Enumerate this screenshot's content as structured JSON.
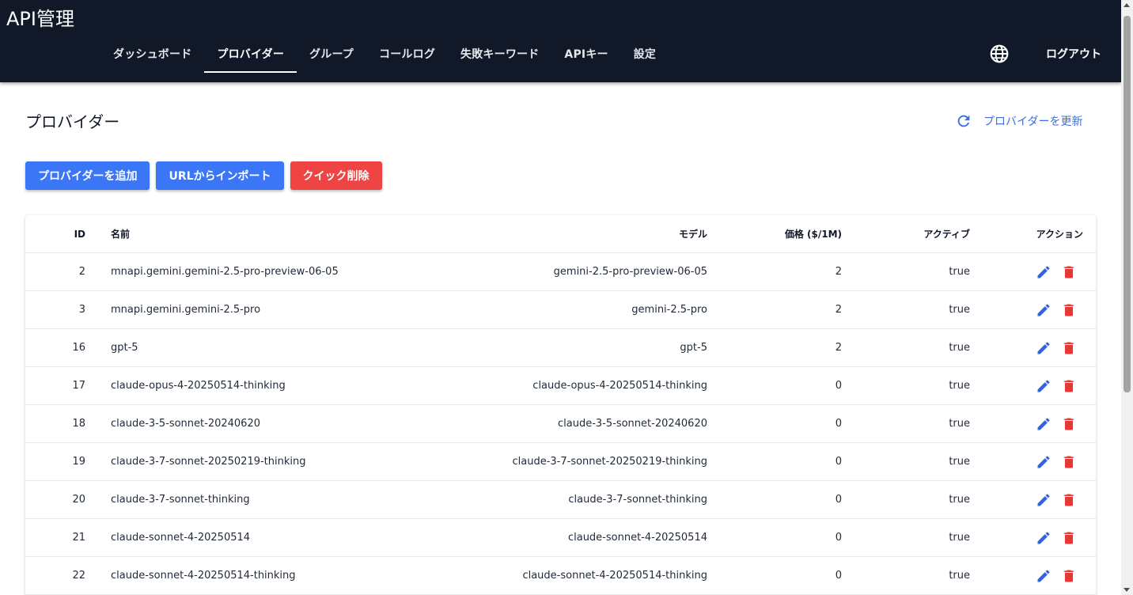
{
  "app": {
    "title": "API管理"
  },
  "nav": {
    "items": [
      {
        "label": "ダッシュボード",
        "active": false
      },
      {
        "label": "プロバイダー",
        "active": true
      },
      {
        "label": "グループ",
        "active": false
      },
      {
        "label": "コールログ",
        "active": false
      },
      {
        "label": "失敗キーワード",
        "active": false
      },
      {
        "label": "APIキー",
        "active": false
      },
      {
        "label": "設定",
        "active": false
      }
    ],
    "language_icon": "globe-icon",
    "logout_label": "ログアウト"
  },
  "page": {
    "title": "プロバイダー",
    "refresh_label": "プロバイダーを更新",
    "refresh_icon": "refresh-icon"
  },
  "toolbar": {
    "add_label": "プロバイダーを追加",
    "import_label": "URLからインポート",
    "quick_delete_label": "クイック削除"
  },
  "table": {
    "headers": {
      "id": "ID",
      "name": "名前",
      "model": "モデル",
      "price": "価格 ($/1M)",
      "active": "アクティブ",
      "action": "アクション"
    },
    "rows": [
      {
        "id": "2",
        "name": "mnapi.gemini.gemini-2.5-pro-preview-06-05",
        "model": "gemini-2.5-pro-preview-06-05",
        "price": "2",
        "active": "true"
      },
      {
        "id": "3",
        "name": "mnapi.gemini.gemini-2.5-pro",
        "model": "gemini-2.5-pro",
        "price": "2",
        "active": "true"
      },
      {
        "id": "16",
        "name": "gpt-5",
        "model": "gpt-5",
        "price": "2",
        "active": "true"
      },
      {
        "id": "17",
        "name": "claude-opus-4-20250514-thinking",
        "model": "claude-opus-4-20250514-thinking",
        "price": "0",
        "active": "true"
      },
      {
        "id": "18",
        "name": "claude-3-5-sonnet-20240620",
        "model": "claude-3-5-sonnet-20240620",
        "price": "0",
        "active": "true"
      },
      {
        "id": "19",
        "name": "claude-3-7-sonnet-20250219-thinking",
        "model": "claude-3-7-sonnet-20250219-thinking",
        "price": "0",
        "active": "true"
      },
      {
        "id": "20",
        "name": "claude-3-7-sonnet-thinking",
        "model": "claude-3-7-sonnet-thinking",
        "price": "0",
        "active": "true"
      },
      {
        "id": "21",
        "name": "claude-sonnet-4-20250514",
        "model": "claude-sonnet-4-20250514",
        "price": "0",
        "active": "true"
      },
      {
        "id": "22",
        "name": "claude-sonnet-4-20250514-thinking",
        "model": "claude-sonnet-4-20250514-thinking",
        "price": "0",
        "active": "true"
      }
    ]
  },
  "colors": {
    "appbar": "#111827",
    "primary": "#3b76f6",
    "danger": "#ef4444",
    "edit_icon": "#2f63d9",
    "delete_icon": "#e53935"
  }
}
